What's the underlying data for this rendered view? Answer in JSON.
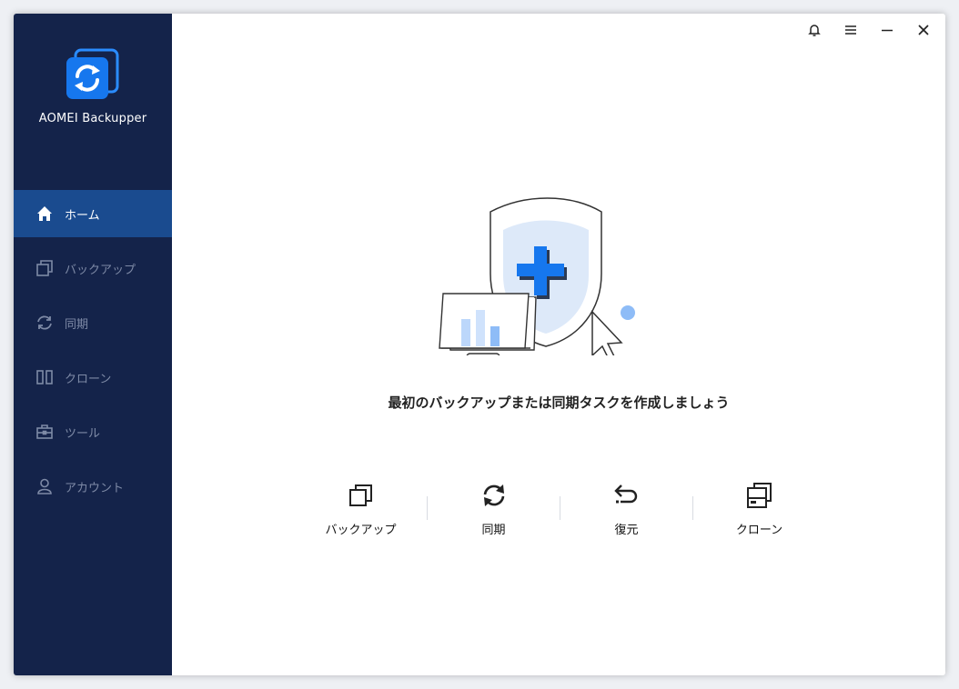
{
  "app": {
    "name": "AOMEI Backupper"
  },
  "sidebar": {
    "items": [
      {
        "id": "home",
        "label": "ホーム",
        "icon": "home-icon",
        "active": true
      },
      {
        "id": "backup",
        "label": "バックアップ",
        "icon": "copy-icon",
        "active": false
      },
      {
        "id": "sync",
        "label": "同期",
        "icon": "sync-icon",
        "active": false
      },
      {
        "id": "clone",
        "label": "クローン",
        "icon": "clone-icon",
        "active": false
      },
      {
        "id": "tools",
        "label": "ツール",
        "icon": "toolbox-icon",
        "active": false
      },
      {
        "id": "account",
        "label": "アカウント",
        "icon": "user-icon",
        "active": false
      }
    ]
  },
  "main": {
    "prompt": "最初のバックアップまたは同期タスクを作成しましょう",
    "actions": [
      {
        "id": "backup",
        "label": "バックアップ",
        "icon": "copy-icon"
      },
      {
        "id": "sync",
        "label": "同期",
        "icon": "sync-icon"
      },
      {
        "id": "restore",
        "label": "復元",
        "icon": "undo-icon"
      },
      {
        "id": "clone",
        "label": "クローン",
        "icon": "clone-drive-icon"
      }
    ]
  },
  "colors": {
    "sidebar_bg": "#14234a",
    "active_bg": "#1a4b8f",
    "accent": "#1677ee",
    "inactive_text": "#7e8aa6"
  }
}
